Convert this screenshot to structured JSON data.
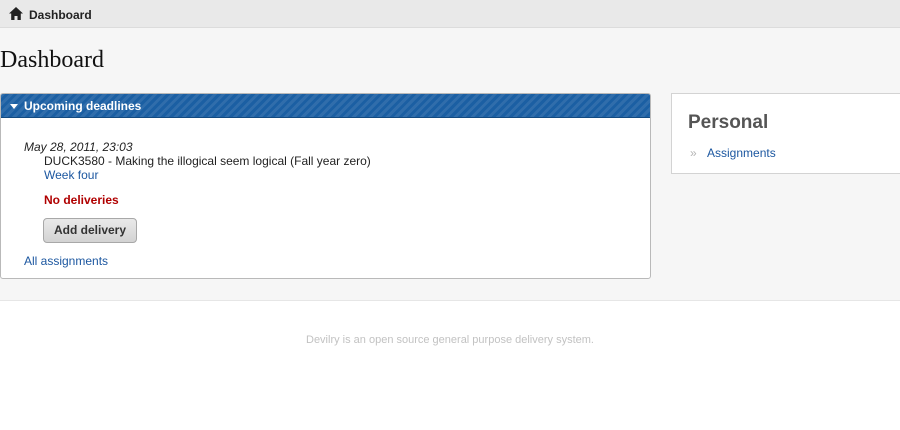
{
  "topbar": {
    "home_icon": "home-icon",
    "breadcrumb": "Dashboard"
  },
  "page": {
    "title": "Dashboard"
  },
  "upcoming": {
    "header": "Upcoming deadlines",
    "collapse_icon": "triangle-down-icon",
    "deadline": {
      "date": "May 28, 2011, 23:03",
      "course": "DUCK3580 - Making the illogical seem logical (Fall year zero)",
      "assignment": "Week four",
      "status": "No deliveries",
      "add_button": "Add delivery"
    },
    "all_assignments_link": "All assignments",
    "colors": {
      "header_bg": "#1b5fa3",
      "link": "#1c57a0",
      "status": "#b00000"
    }
  },
  "personal": {
    "title": "Personal",
    "bullet": "»",
    "link": "Assignments"
  },
  "footer": {
    "text": "Devilry is an open source general purpose delivery system."
  }
}
